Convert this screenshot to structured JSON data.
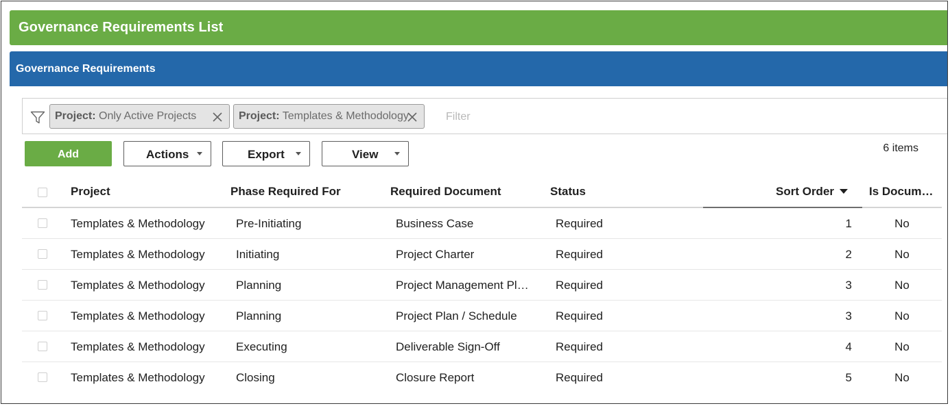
{
  "page": {
    "title": "Governance Requirements List"
  },
  "panel": {
    "title": "Governance Requirements"
  },
  "filters": {
    "chips": [
      {
        "key": "Project:",
        "value": "Only Active Projects"
      },
      {
        "key": "Project:",
        "value": "Templates & Methodology"
      }
    ],
    "placeholder": "Filter"
  },
  "toolbar": {
    "add_label": "Add",
    "actions_label": "Actions",
    "export_label": "Export",
    "view_label": "View",
    "item_count": "6 items"
  },
  "table": {
    "columns": {
      "project": "Project",
      "phase": "Phase Required For",
      "document": "Required Document",
      "status": "Status",
      "sort_order": "Sort Order",
      "is_document": "Is Docum…"
    },
    "sorted_column": "sort_order",
    "sort_direction": "descending",
    "rows": [
      {
        "project": "Templates & Methodology",
        "phase": "Pre-Initiating",
        "document": "Business Case",
        "status": "Required",
        "sort_order": "1",
        "is_document": "No"
      },
      {
        "project": "Templates & Methodology",
        "phase": "Initiating",
        "document": "Project Charter",
        "status": "Required",
        "sort_order": "2",
        "is_document": "No"
      },
      {
        "project": "Templates & Methodology",
        "phase": "Planning",
        "document": "Project Management Pl…",
        "status": "Required",
        "sort_order": "3",
        "is_document": "No"
      },
      {
        "project": "Templates & Methodology",
        "phase": "Planning",
        "document": "Project Plan / Schedule",
        "status": "Required",
        "sort_order": "3",
        "is_document": "No"
      },
      {
        "project": "Templates & Methodology",
        "phase": "Executing",
        "document": "Deliverable Sign-Off",
        "status": "Required",
        "sort_order": "4",
        "is_document": "No"
      },
      {
        "project": "Templates & Methodology",
        "phase": "Closing",
        "document": "Closure Report",
        "status": "Required",
        "sort_order": "5",
        "is_document": "No"
      }
    ]
  },
  "colors": {
    "header_green": "#6aac45",
    "panel_blue": "#2468aa"
  }
}
